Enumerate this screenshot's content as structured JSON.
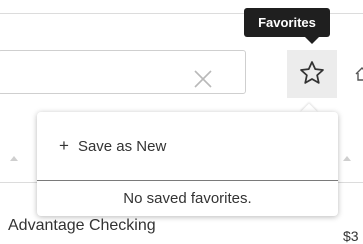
{
  "tooltip": {
    "text": "Favorites"
  },
  "search": {
    "clear_icon": "close-icon"
  },
  "favorites_button": {
    "icon": "star-icon"
  },
  "dropdown": {
    "save_item": {
      "icon": "plus-icon",
      "icon_glyph": "+",
      "label": "Save as New"
    },
    "empty_message": "No saved favorites."
  },
  "account": {
    "name": "Advantage Checking",
    "amount_partial": "$3"
  },
  "colors": {
    "tooltip_bg": "#1f1f1f",
    "button_bg": "#ececec",
    "text": "#333333"
  }
}
